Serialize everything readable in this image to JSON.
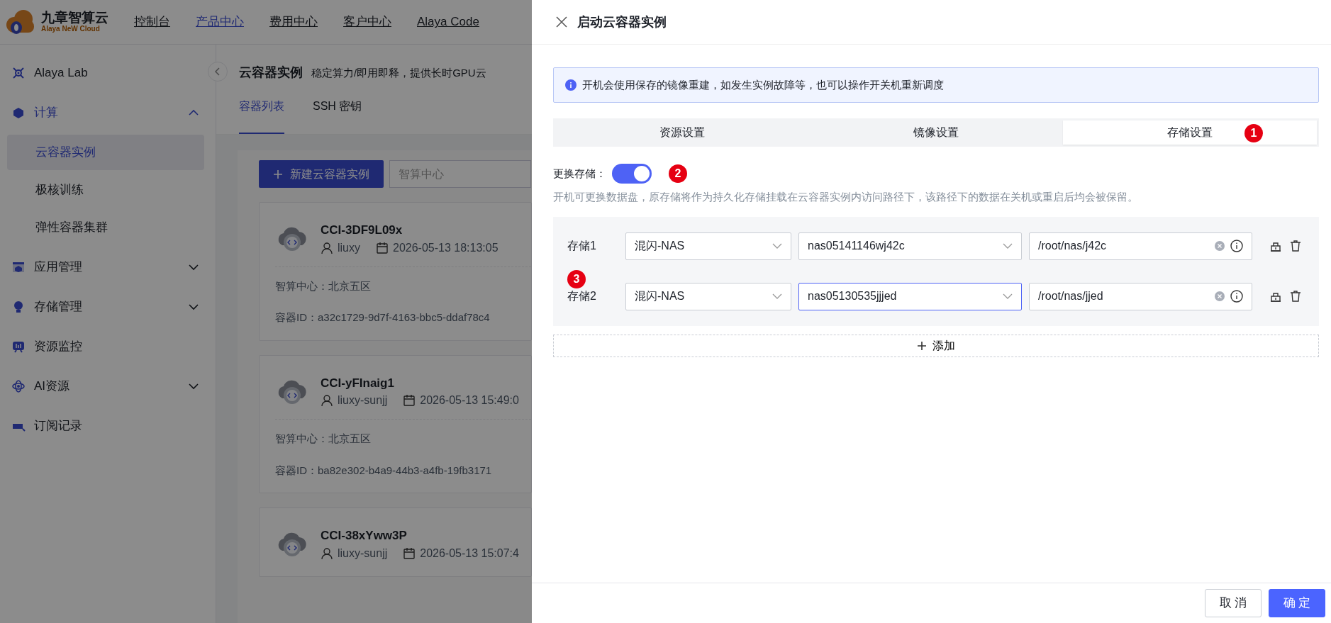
{
  "header": {
    "logo": {
      "name": "九章智算云",
      "tagline": "Alaya NeW Cloud"
    },
    "nav": [
      {
        "label": "控制台",
        "selected": false
      },
      {
        "label": "产品中心",
        "selected": true
      },
      {
        "label": "费用中心",
        "selected": false
      },
      {
        "label": "客户中心",
        "selected": false
      },
      {
        "label": "Alaya Code",
        "selected": false
      }
    ]
  },
  "sidebar": {
    "items": [
      {
        "kind": "link",
        "label": "Alaya Lab"
      },
      {
        "kind": "group",
        "label": "计算",
        "expanded": true,
        "children": [
          {
            "label": "云容器实例",
            "selected": true
          },
          {
            "label": "极核训练",
            "selected": false
          },
          {
            "label": "弹性容器集群",
            "selected": false
          }
        ]
      },
      {
        "kind": "group",
        "label": "应用管理",
        "expanded": false
      },
      {
        "kind": "group",
        "label": "存储管理",
        "expanded": false
      },
      {
        "kind": "link",
        "label": "资源监控"
      },
      {
        "kind": "group",
        "label": "AI资源",
        "expanded": false
      },
      {
        "kind": "link",
        "label": "订阅记录"
      }
    ]
  },
  "page": {
    "title": "云容器实例",
    "subtitle": "稳定算力/即用即释，提供长时GPU云",
    "tabs": [
      {
        "label": "容器列表",
        "selected": true
      },
      {
        "label": "SSH 密钥",
        "selected": false
      }
    ],
    "new_button": "新建云容器实例",
    "filter": {
      "placeholder": "智算中心"
    },
    "instances": [
      {
        "name": "CCI-3DF9L09x",
        "user": "liuxy",
        "created": "2026-05-13 18:13:05",
        "center_label": "智算中心：",
        "center": "北京五区",
        "id_label": "容器ID：",
        "id": "a32c1729-9d7f-4163-bbc5-ddaf78c4"
      },
      {
        "name": "CCI-yFInaig1",
        "user": "liuxy-sunjj",
        "created": "2026-05-13 15:49:0",
        "center_label": "智算中心：",
        "center": "北京五区",
        "id_label": "容器ID：",
        "id": "ba82e302-b4a9-44b3-a4fb-19fb3171"
      },
      {
        "name": "CCI-38xYww3P",
        "user": "liuxy-sunjj",
        "created": "2026-05-13 15:07:4"
      }
    ]
  },
  "drawer": {
    "title": "启动云容器实例",
    "alert": "开机会使用保存的镜像重建，如发生实例故障等，也可以操作开关机重新调度",
    "tabs": [
      {
        "label": "资源设置",
        "selected": false
      },
      {
        "label": "镜像设置",
        "selected": false
      },
      {
        "label": "存储设置",
        "selected": true,
        "marker": "1"
      }
    ],
    "switch": {
      "label": "更换存储：",
      "on": true,
      "marker": "2"
    },
    "help": "开机可更换数据盘，原存储将作为持久化存储挂载在云容器实例内访问路径下，该路径下的数据在关机或重启后均会被保留。",
    "storage_marker": "3",
    "storages": [
      {
        "label": "存储1",
        "type": "混闪-NAS",
        "volume": "nas05141146wj42c",
        "path": "/root/nas/j42c",
        "focused": false
      },
      {
        "label": "存储2",
        "type": "混闪-NAS",
        "volume": "nas05130535jjjed",
        "path": "/root/nas/jjed",
        "focused": true
      }
    ],
    "add_button": "添加",
    "buttons": [
      {
        "label": "取 消",
        "kind": "default"
      },
      {
        "label": "确 定",
        "kind": "primary"
      }
    ]
  }
}
